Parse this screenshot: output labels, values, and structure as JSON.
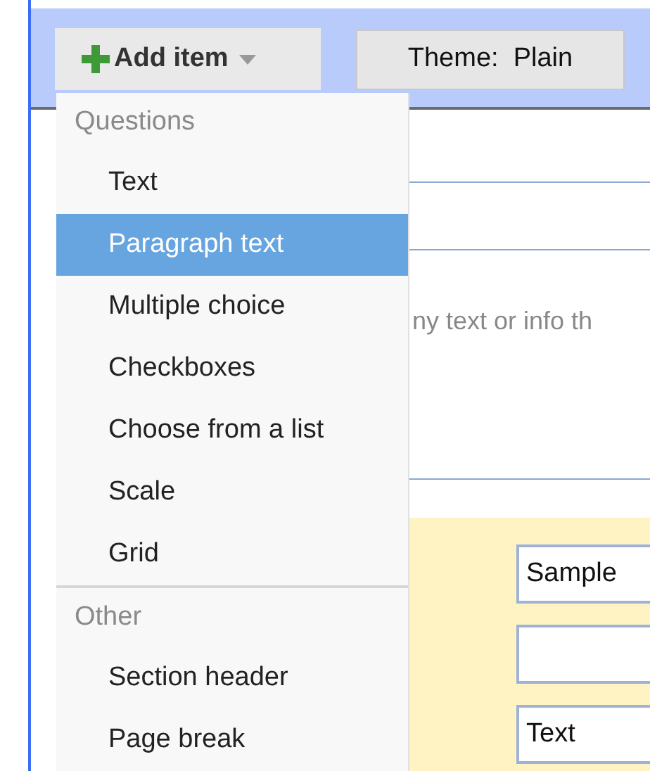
{
  "toolbar": {
    "add_button": {
      "label": "Add item",
      "expanded": true
    },
    "theme_button": {
      "label": "Theme:  Plain"
    }
  },
  "menu": {
    "sections": [
      {
        "header": "Questions",
        "items": [
          {
            "label": "Text",
            "selected": false
          },
          {
            "label": "Paragraph text",
            "selected": true
          },
          {
            "label": "Multiple choice",
            "selected": false
          },
          {
            "label": "Checkboxes",
            "selected": false
          },
          {
            "label": "Choose from a list",
            "selected": false
          },
          {
            "label": "Scale",
            "selected": false
          },
          {
            "label": "Grid",
            "selected": false
          }
        ]
      },
      {
        "header": "Other",
        "items": [
          {
            "label": "Section header",
            "selected": false
          },
          {
            "label": "Page break",
            "selected": false
          }
        ]
      }
    ]
  },
  "form": {
    "description_hint": "ny text or info th",
    "fields": [
      {
        "kind": "text",
        "value": "Sample"
      },
      {
        "kind": "blank"
      },
      {
        "kind": "text",
        "value": "Text"
      }
    ]
  }
}
